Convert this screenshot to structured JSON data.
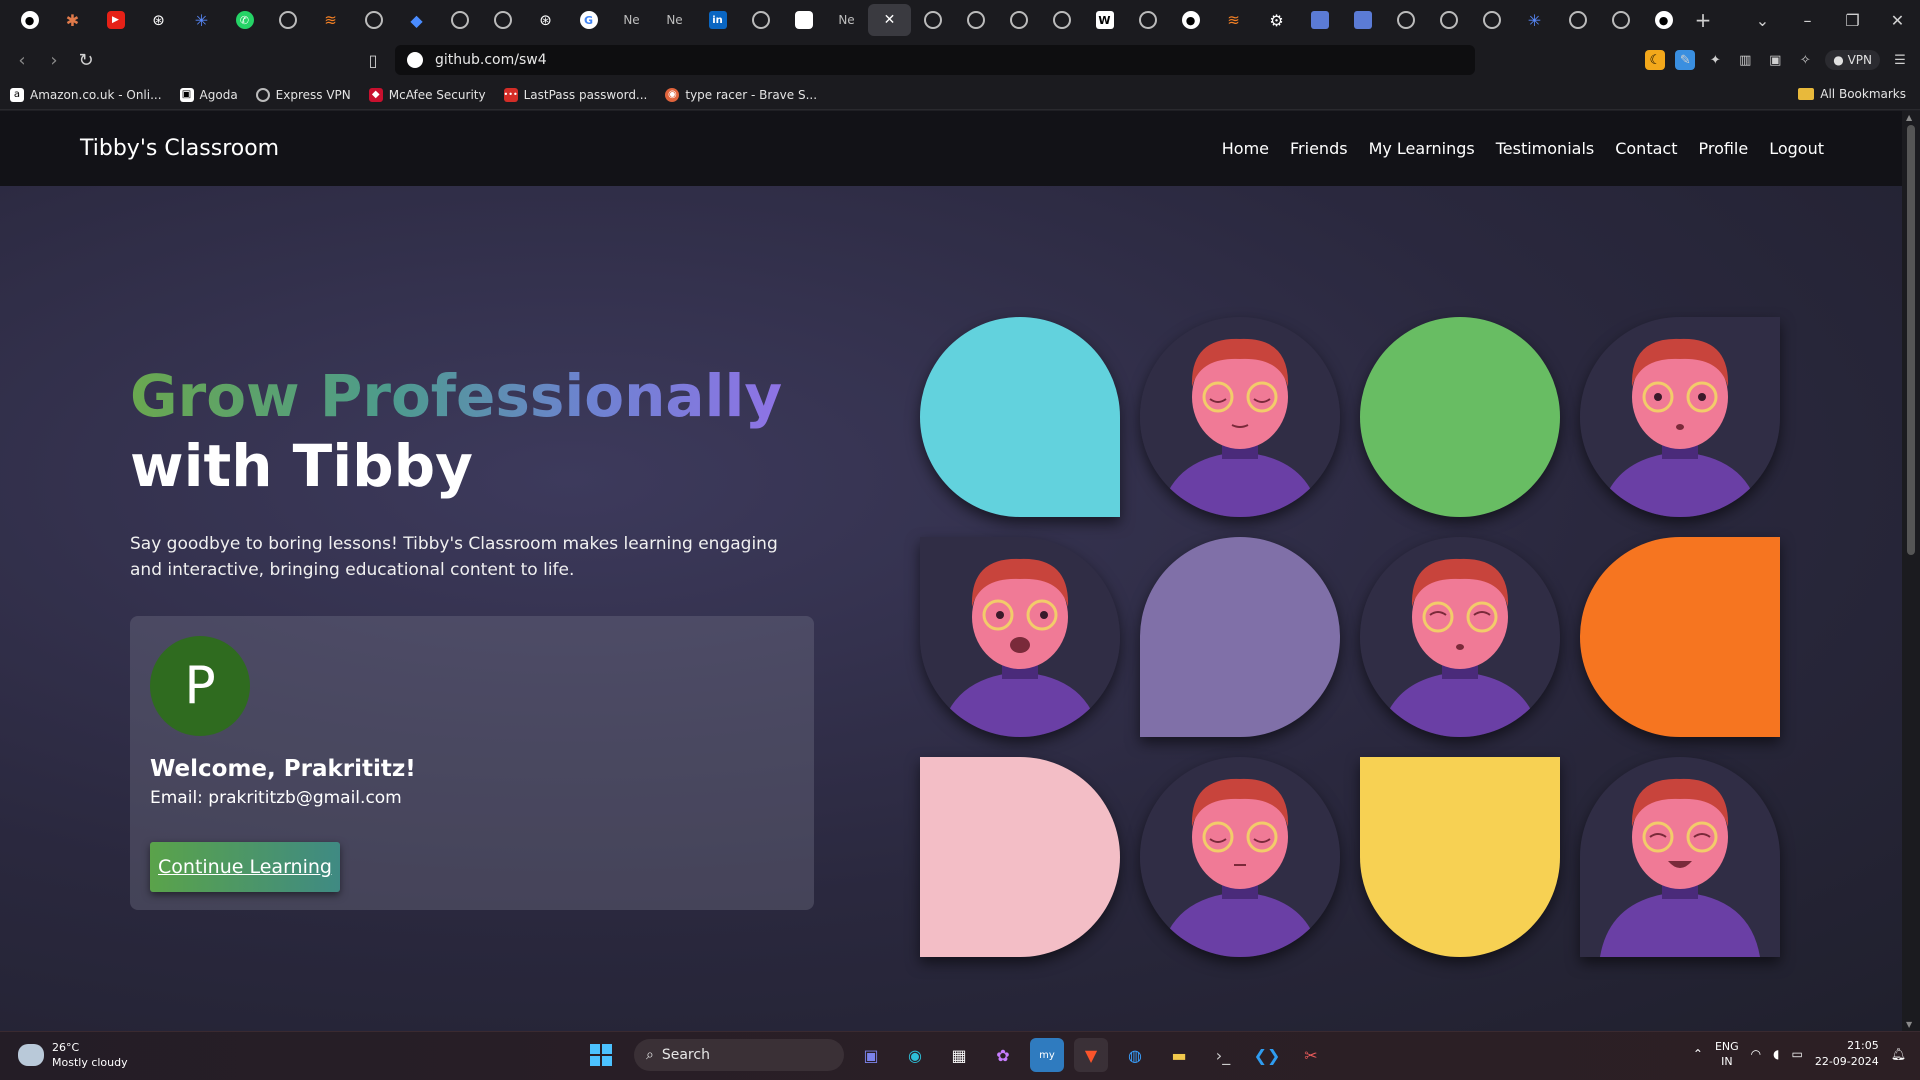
{
  "browser": {
    "tab_labels": [
      "Ne",
      "Ne",
      "Ne"
    ],
    "address": "github.com/sw4",
    "vpn_label": "VPN",
    "window_controls": [
      "⌄",
      "–",
      "❐",
      "✕"
    ],
    "bookmarks": [
      {
        "label": "Amazon.co.uk - Onli...",
        "color": "#ffffff"
      },
      {
        "label": "Agoda",
        "color": "#ffffff"
      },
      {
        "label": "Express VPN",
        "color": "#d0d0d0"
      },
      {
        "label": "McAfee Security",
        "color": "#c8102e"
      },
      {
        "label": "LastPass password...",
        "color": "#d32d27"
      },
      {
        "label": "type racer - Brave S...",
        "color": "#e0643c"
      }
    ],
    "all_bookmarks": "All Bookmarks"
  },
  "site": {
    "brand": "Tibby's Classroom",
    "nav": [
      "Home",
      "Friends",
      "My Learnings",
      "Testimonials",
      "Contact",
      "Profile",
      "Logout"
    ],
    "hero_line1": "Grow Professionally",
    "hero_line2": "with Tibby",
    "description": "Say goodbye to boring lessons! Tibby's Classroom makes learning engaging and interactive, bringing educational content to life.",
    "user": {
      "initial": "P",
      "welcome": "Welcome, Prakrititz!",
      "email": "Email: prakrititzb@gmail.com"
    },
    "cta": "Continue Learning",
    "tile_colors": [
      "#62d2dd",
      "#68bd63",
      "#8070a8",
      "#f67520",
      "#f3bec6",
      "#f7d153"
    ]
  },
  "taskbar": {
    "temperature": "26°C",
    "weather": "Mostly cloudy",
    "search_placeholder": "Search",
    "lang_top": "ENG",
    "lang_bottom": "IN",
    "time": "21:05",
    "date": "22-09-2024"
  }
}
